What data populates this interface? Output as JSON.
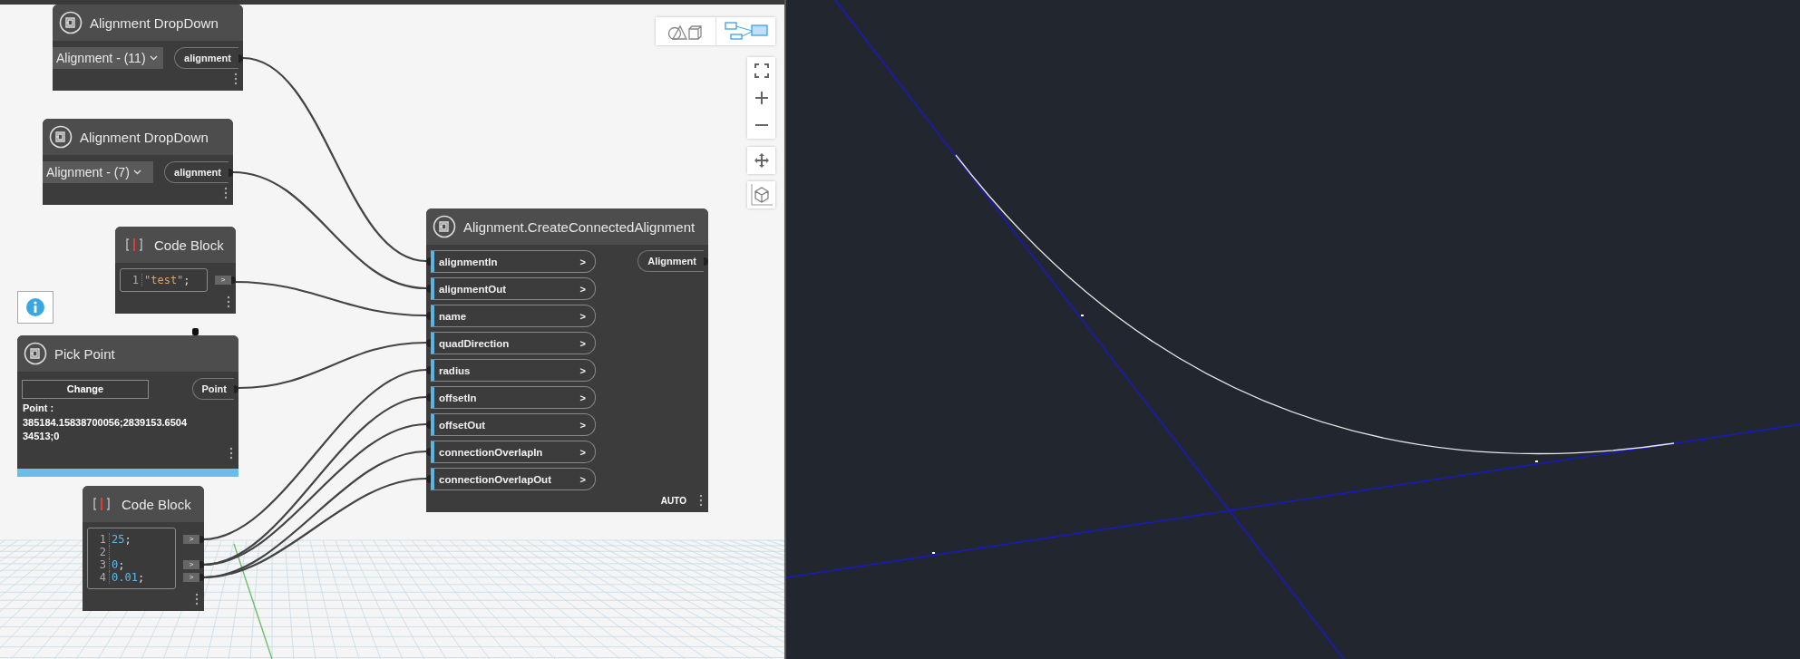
{
  "view_toggle": [
    {
      "kind": "geometry",
      "selected": false
    },
    {
      "kind": "graph",
      "selected": true
    }
  ],
  "nodes": [
    {
      "kind": "dropdown",
      "title": "Alignment DropDown",
      "value": "Alignment - (11)",
      "outputs": [
        "alignment"
      ]
    },
    {
      "kind": "dropdown",
      "title": "Alignment DropDown",
      "value": "Alignment - (7)",
      "outputs": [
        "alignment"
      ]
    },
    {
      "kind": "code",
      "title": "Code Block",
      "lines": [
        {
          "number": "1",
          "value": "\"test\"",
          "end": ";",
          "kind": "string",
          "output": ">"
        }
      ]
    },
    {
      "kind": "pick",
      "title": "Pick Point",
      "info": true,
      "button": "Change",
      "label": "Point :",
      "value": "385184.15838700056;2839153.650434513;0",
      "outputs": [
        "Point"
      ],
      "highlighted": true
    },
    {
      "kind": "code",
      "title": "Code Block",
      "lines": [
        {
          "number": "1",
          "value": "25",
          "end": ";",
          "kind": "number",
          "output": ">"
        },
        {
          "number": "2"
        },
        {
          "number": "3",
          "value": "0",
          "end": ";",
          "kind": "number",
          "output": ">"
        },
        {
          "number": "4",
          "value": "0.01",
          "end": ";",
          "kind": "number",
          "output": ">"
        }
      ]
    },
    {
      "kind": "function",
      "title": "Alignment.CreateConnectedAlignment",
      "inputs": [
        {
          "name": "alignmentIn",
          "hint": ">"
        },
        {
          "name": "alignmentOut",
          "hint": ">"
        },
        {
          "name": "name",
          "hint": ">"
        },
        {
          "name": "quadDirection",
          "hint": ">"
        },
        {
          "name": "radius",
          "hint": ">"
        },
        {
          "name": "offsetIn",
          "hint": ">"
        },
        {
          "name": "offsetOut",
          "hint": ">"
        },
        {
          "name": "connectionOverlapIn",
          "hint": ">"
        },
        {
          "name": "connectionOverlapOut",
          "hint": ">"
        }
      ],
      "outputs": [
        "Alignment"
      ],
      "run_mode": "AUTO"
    }
  ]
}
